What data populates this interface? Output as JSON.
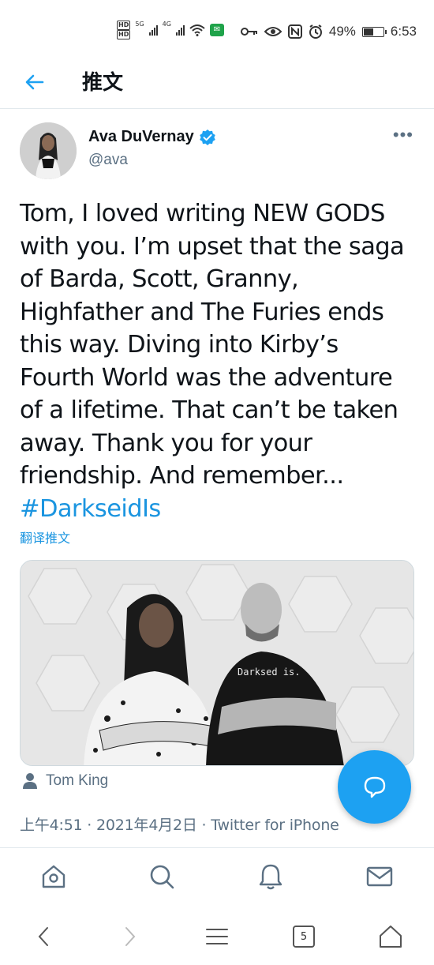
{
  "status_bar": {
    "hd_top": "HD",
    "hd_bottom": "HD",
    "net1": "5G",
    "net2": "4G",
    "battery_percent": "49%",
    "battery_level": 0.49,
    "time": "6:53"
  },
  "header": {
    "back_icon": "arrow-left-icon",
    "title": "推文"
  },
  "tweet": {
    "author_name": "Ava DuVernay",
    "author_handle": "@ava",
    "verified": true,
    "text": "Tom, I loved writing NEW GODS with you. I’m upset that the saga of Barda, Scott, Granny, Highfather and The Furies ends this way. Diving into Kirby’s Fourth World was the adventure of a lifetime. That can’t be taken away. Thank you for your friendship. And remember...",
    "hashtag": "#DarkseidIs",
    "translate_label": "翻译推文",
    "media_shirt_text": "Darksed is.",
    "tagged_user": "Tom King",
    "meta": "上午4:51 · 2021年4月2日 · Twitter for iPhone"
  },
  "tabs": [
    {
      "icon": "home-icon"
    },
    {
      "icon": "search-icon"
    },
    {
      "icon": "notifications-bell-icon"
    },
    {
      "icon": "messages-envelope-icon"
    }
  ],
  "system_nav": {
    "tabs_count": "5"
  },
  "colors": {
    "accent": "#1da1f2",
    "link": "#1b95e0",
    "secondary_text": "#5b7083",
    "divider": "#e1e8ed"
  }
}
